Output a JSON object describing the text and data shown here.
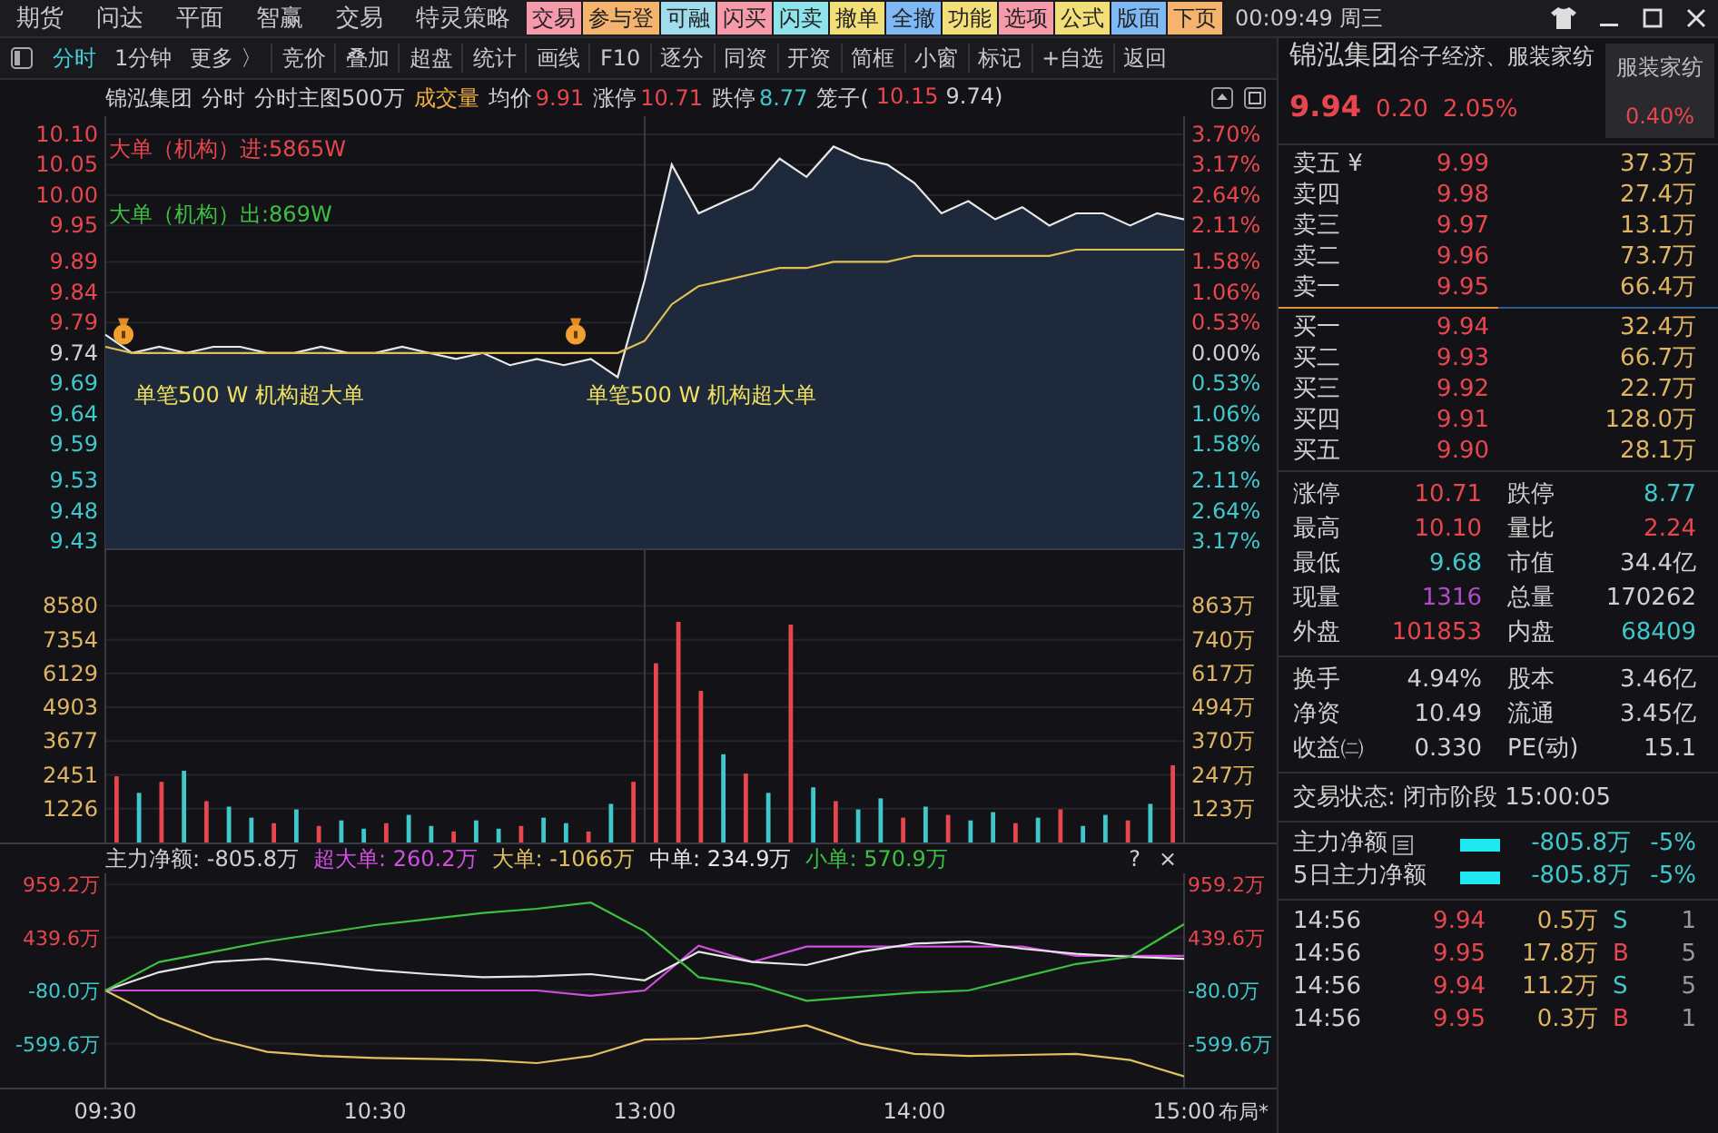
{
  "menu_bar": {
    "items": [
      "期货",
      "问达",
      "平面",
      "智赢",
      "交易",
      "特灵策略"
    ],
    "buttons": [
      {
        "label": "交易",
        "color": "#f49aab"
      },
      {
        "label": "参与登",
        "color": "#f5b46e"
      },
      {
        "label": "可融",
        "color": "#9fdcec"
      },
      {
        "label": "闪买",
        "color": "#f49aab"
      },
      {
        "label": "闪卖",
        "color": "#8fe3ea"
      },
      {
        "label": "撤单",
        "color": "#f3df78"
      },
      {
        "label": "全撤",
        "color": "#7fb9f5"
      },
      {
        "label": "功能",
        "color": "#f3df78"
      },
      {
        "label": "选项",
        "color": "#f49aab"
      },
      {
        "label": "公式",
        "color": "#f3df78"
      },
      {
        "label": "版面",
        "color": "#7fb9f5"
      },
      {
        "label": "下页",
        "color": "#f5b46e"
      }
    ],
    "clock": "00:09:49 周三"
  },
  "toolbar": {
    "tabs": [
      {
        "label": "分时",
        "selected": true
      },
      {
        "label": "1分钟",
        "selected": false
      },
      {
        "label": "更多 〉",
        "selected": false
      }
    ],
    "buttons": [
      "竞价",
      "叠加",
      "超盘",
      "统计",
      "画线",
      "F10",
      "逐分",
      "同资",
      "开资",
      "简框",
      "小窗",
      "标记",
      "+自选",
      "返回"
    ]
  },
  "chart_header": {
    "stock": "锦泓集团",
    "period": "分时",
    "template": "分时主图500万",
    "indicator": "成交量",
    "fields": [
      {
        "label": "均价",
        "value": "9.91",
        "color": "#e8464e"
      },
      {
        "label": "涨停",
        "value": "10.71",
        "color": "#e8464e"
      },
      {
        "label": "跌停",
        "value": "8.77",
        "color": "#3fc8cc"
      }
    ],
    "cage": {
      "label": "笼子(",
      "high": "10.15",
      "low": "9.74)"
    }
  },
  "price_panel": {
    "notes": [
      {
        "text": "大单（机构）进:5865W",
        "kind": "inflow"
      },
      {
        "text": "大单（机构）出:869W",
        "kind": "outflow"
      }
    ],
    "markers": [
      "单笔500 W 机构超大单",
      "单笔500 W 机构超大单"
    ],
    "right_ticks": [
      {
        "label": "3.70%",
        "color": "#e8464e"
      },
      {
        "label": "3.17%",
        "color": "#e8464e"
      },
      {
        "label": "2.64%",
        "color": "#e8464e"
      },
      {
        "label": "2.11%",
        "color": "#e8464e"
      },
      {
        "label": "1.58%",
        "color": "#e8464e"
      },
      {
        "label": "1.06%",
        "color": "#e8464e"
      },
      {
        "label": "0.53%",
        "color": "#e8464e"
      },
      {
        "label": "0.00%",
        "color": "#d0d0d0"
      },
      {
        "label": "0.53%",
        "color": "#3fc8cc"
      },
      {
        "label": "1.06%",
        "color": "#3fc8cc"
      },
      {
        "label": "1.58%",
        "color": "#3fc8cc"
      },
      {
        "label": "2.11%",
        "color": "#3fc8cc"
      },
      {
        "label": "2.64%",
        "color": "#3fc8cc"
      },
      {
        "label": "3.17%",
        "color": "#3fc8cc"
      }
    ],
    "chart_data": {
      "type": "area",
      "grid": true,
      "ylim": [
        9.418,
        10.13
      ],
      "yticks": [
        {
          "value": 10.1,
          "label": "10.10"
        },
        {
          "value": 10.05,
          "label": "10.05"
        },
        {
          "value": 10.0,
          "label": "10.00"
        },
        {
          "value": 9.95,
          "label": "9.95"
        },
        {
          "value": 9.89,
          "label": "9.89"
        },
        {
          "value": 9.84,
          "label": "9.84"
        },
        {
          "value": 9.79,
          "label": "9.79"
        },
        {
          "value": 9.74,
          "label": "9.74"
        },
        {
          "value": 9.69,
          "label": "9.69"
        },
        {
          "value": 9.64,
          "label": "9.64"
        },
        {
          "value": 9.59,
          "label": "9.59"
        },
        {
          "value": 9.53,
          "label": "9.53"
        },
        {
          "value": 9.48,
          "label": "9.48"
        },
        {
          "value": 9.43,
          "label": "9.43"
        }
      ],
      "categories": [
        null,
        null,
        null,
        null,
        null,
        null,
        null,
        null,
        null,
        null,
        null,
        null,
        null,
        null,
        null,
        null,
        null,
        null,
        null,
        null,
        null,
        null,
        null,
        null,
        null,
        null,
        null,
        null,
        null,
        null,
        null,
        null,
        null,
        null,
        null,
        null,
        null,
        null,
        null,
        null,
        null
      ],
      "series": [
        {
          "color": "#e8e8e8",
          "values": [
            9.77,
            9.74,
            9.75,
            9.74,
            9.75,
            9.75,
            9.74,
            9.74,
            9.75,
            9.74,
            9.74,
            9.75,
            9.74,
            9.73,
            9.74,
            9.72,
            9.73,
            9.72,
            9.73,
            9.7,
            9.86,
            10.05,
            9.97,
            9.99,
            10.01,
            10.06,
            10.03,
            10.08,
            10.06,
            10.05,
            10.02,
            9.97,
            9.99,
            9.96,
            9.98,
            9.95,
            9.97,
            9.97,
            9.95,
            9.97,
            9.96
          ]
        },
        {
          "type": "line",
          "color": "#e0c050",
          "values": [
            9.75,
            9.74,
            9.74,
            9.74,
            9.74,
            9.74,
            9.74,
            9.74,
            9.74,
            9.74,
            9.74,
            9.74,
            9.74,
            9.74,
            9.74,
            9.74,
            9.74,
            9.74,
            9.74,
            9.74,
            9.76,
            9.82,
            9.85,
            9.86,
            9.87,
            9.88,
            9.88,
            9.89,
            9.89,
            9.89,
            9.9,
            9.9,
            9.9,
            9.9,
            9.9,
            9.9,
            9.91,
            9.91,
            9.91,
            9.91,
            9.91
          ]
        }
      ]
    }
  },
  "volume_panel": {
    "right_ticks": [
      "863万",
      "740万",
      "617万",
      "494万",
      "370万",
      "247万",
      "123万"
    ],
    "bar_up": [
      true,
      false,
      true,
      false,
      true,
      false,
      false,
      true,
      false,
      true,
      false,
      false,
      true,
      false,
      false,
      true,
      false,
      false,
      true,
      false,
      false,
      true,
      false,
      true,
      true,
      true,
      true,
      false,
      true,
      false,
      true,
      false,
      true,
      false,
      false,
      true,
      false,
      true,
      false,
      false,
      true,
      false,
      true,
      false,
      false,
      true,
      false,
      true
    ],
    "chart_data": {
      "type": "bar",
      "grid": true,
      "ylim": [
        0,
        10667
      ],
      "yticks": [
        8580,
        7354,
        6129,
        4903,
        3677,
        2451,
        1226
      ],
      "categories": [
        null,
        null,
        null,
        null,
        null,
        null,
        null,
        null,
        null,
        null,
        null,
        null,
        null,
        null,
        null,
        null,
        null,
        null,
        null,
        null,
        null,
        null,
        null,
        null,
        null,
        null,
        null,
        null,
        null,
        null,
        null,
        null,
        null,
        null,
        null,
        null,
        null,
        null,
        null,
        null,
        null,
        null,
        null,
        null,
        null,
        null,
        null,
        null
      ],
      "series": [
        {
          "values": [
            2400,
            1800,
            2200,
            2600,
            1500,
            1300,
            900,
            700,
            1200,
            600,
            800,
            500,
            700,
            1000,
            600,
            400,
            800,
            500,
            600,
            900,
            700,
            400,
            1400,
            2200,
            6500,
            8000,
            5500,
            3200,
            2500,
            1800,
            7900,
            2000,
            1500,
            1200,
            1600,
            900,
            1300,
            1000,
            800,
            1100,
            700,
            900,
            1200,
            600,
            1000,
            800,
            1400,
            2800
          ]
        }
      ]
    }
  },
  "flow_panel": {
    "net": {
      "label": "主力净额:",
      "value": "-805.8万"
    },
    "legend_values": [
      "260.2万",
      "-1066万",
      "234.9万",
      "570.9万"
    ],
    "help": "?",
    "close": "×",
    "layout_button": "布局*",
    "right_ticks": [
      "959.2万",
      "439.6万",
      "-80.0万",
      "-599.6万"
    ],
    "chart_data": {
      "type": "line",
      "grid": true,
      "ylim": [
        -1030,
        1067
      ],
      "yticks": [
        {
          "value": 959.2,
          "label": "959.2万"
        },
        {
          "value": 439.6,
          "label": "439.6万"
        },
        {
          "value": -80.0,
          "label": "-80.0万"
        },
        {
          "value": -599.6,
          "label": "-599.6万"
        }
      ],
      "categories": [
        "09:30",
        null,
        null,
        null,
        null,
        "10:30",
        null,
        null,
        null,
        null,
        "13:00",
        null,
        null,
        null,
        null,
        "14:00",
        null,
        null,
        null,
        null,
        "15:00"
      ],
      "series": [
        {
          "name": "超大单:",
          "color": "#d04ee0",
          "values": [
            -80,
            -80,
            -80,
            -80,
            -80,
            -80,
            -80,
            -80,
            -80,
            -130,
            -80,
            360,
            200,
            350,
            350,
            350,
            350,
            350,
            260,
            260,
            260
          ]
        },
        {
          "name": "大单:",
          "color": "#e0c060",
          "values": [
            -80,
            -350,
            -550,
            -680,
            -720,
            -740,
            -750,
            -760,
            -790,
            -720,
            -560,
            -550,
            -500,
            -420,
            -600,
            -700,
            -720,
            -710,
            -700,
            -760,
            -920
          ]
        },
        {
          "name": "中单:",
          "color": "#e6e6e6",
          "values": [
            -80,
            100,
            200,
            230,
            180,
            120,
            80,
            50,
            60,
            80,
            20,
            300,
            200,
            170,
            300,
            380,
            400,
            330,
            280,
            250,
            230
          ]
        },
        {
          "name": "小单:",
          "color": "#3cc040",
          "values": [
            -80,
            200,
            300,
            400,
            480,
            560,
            620,
            680,
            720,
            780,
            500,
            50,
            -20,
            -180,
            -140,
            -100,
            -80,
            50,
            180,
            250,
            570
          ]
        }
      ]
    }
  },
  "quote_panel": {
    "name": "锦泓集团",
    "concepts": "谷子经济、服装家纺",
    "sector": {
      "name": "服装家纺",
      "change": "0.40%",
      "color": "#e8464e"
    },
    "price": "9.94",
    "change": "0.20",
    "change_pct": "2.05%",
    "color": "#e8464e",
    "asks": [
      {
        "label": "卖五 ¥",
        "price": "9.99",
        "volume": "37.3万",
        "color": "#e8464e"
      },
      {
        "label": "卖四",
        "price": "9.98",
        "volume": "27.4万",
        "color": "#e8464e"
      },
      {
        "label": "卖三",
        "price": "9.97",
        "volume": "13.1万",
        "color": "#e8464e"
      },
      {
        "label": "卖二",
        "price": "9.96",
        "volume": "73.7万",
        "color": "#e8464e"
      },
      {
        "label": "卖一",
        "price": "9.95",
        "volume": "66.4万",
        "color": "#e8464e"
      }
    ],
    "bids": [
      {
        "label": "买一",
        "price": "9.94",
        "volume": "32.4万",
        "color": "#e8464e"
      },
      {
        "label": "买二",
        "price": "9.93",
        "volume": "66.7万",
        "color": "#e8464e"
      },
      {
        "label": "买三",
        "price": "9.92",
        "volume": "22.7万",
        "color": "#e8464e"
      },
      {
        "label": "买四",
        "price": "9.91",
        "volume": "128.0万",
        "color": "#e8464e"
      },
      {
        "label": "买五",
        "price": "9.90",
        "volume": "28.1万",
        "color": "#e8464e"
      }
    ],
    "stats": [
      {
        "label": "涨停",
        "value": "10.71",
        "color": "#e8464e"
      },
      {
        "label": "跌停",
        "value": "8.77",
        "color": "#3fc8cc"
      },
      {
        "label": "最高",
        "value": "10.10",
        "color": "#e8464e"
      },
      {
        "label": "量比",
        "value": "2.24",
        "color": "#e8464e"
      },
      {
        "label": "最低",
        "value": "9.68",
        "color": "#3fc8cc"
      },
      {
        "label": "市值",
        "value": "34.4亿",
        "color": "#d0d0d0"
      },
      {
        "label": "现量",
        "value": "1316",
        "color": "#b04cc8"
      },
      {
        "label": "总量",
        "value": "170262",
        "color": "#d0d0d0"
      },
      {
        "label": "外盘",
        "value": "101853",
        "color": "#e8464e"
      },
      {
        "label": "内盘",
        "value": "68409",
        "color": "#3fc8cc"
      }
    ],
    "stats2": [
      {
        "label": "换手",
        "value": "4.94%"
      },
      {
        "label": "股本",
        "value": "3.46亿"
      },
      {
        "label": "净资",
        "value": "10.49"
      },
      {
        "label": "流通",
        "value": "3.45亿"
      },
      {
        "label": "收益㈡",
        "value": "0.330"
      },
      {
        "label": "PE(动)",
        "value": "15.1"
      }
    ],
    "status": "交易状态: 闭市阶段 15:00:05",
    "flows": [
      {
        "label": "主力净额",
        "has_detail": true,
        "value": "-805.8万",
        "pct": "-5%"
      },
      {
        "label": "5日主力净额",
        "has_detail": false,
        "value": "-805.8万",
        "pct": "-5%"
      }
    ],
    "ticks": [
      {
        "time": "14:56",
        "price": "9.94",
        "color": "#e8464e",
        "volume": "0.5万",
        "side": "S",
        "kind": "sell",
        "count": "1"
      },
      {
        "time": "14:56",
        "price": "9.95",
        "color": "#e8464e",
        "volume": "17.8万",
        "side": "B",
        "kind": "buy",
        "count": "5"
      },
      {
        "time": "14:56",
        "price": "9.94",
        "color": "#e8464e",
        "volume": "11.2万",
        "side": "S",
        "kind": "sell",
        "count": "5"
      },
      {
        "time": "14:56",
        "price": "9.95",
        "color": "#e8464e",
        "volume": "0.3万",
        "side": "B",
        "kind": "buy",
        "count": "1"
      }
    ]
  }
}
